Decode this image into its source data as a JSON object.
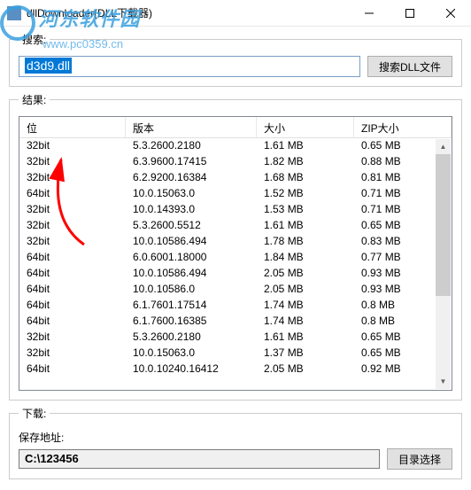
{
  "window": {
    "title": "dllDownloader(DLL下载器)"
  },
  "watermark": {
    "text": "河东软件园",
    "url": "www.pc0359.cn"
  },
  "search": {
    "legend": "搜索:",
    "value": "d3d9.dll",
    "button": "搜索DLL文件"
  },
  "results": {
    "legend": "结果:",
    "headers": {
      "bit": "位",
      "version": "版本",
      "size": "大小",
      "zip": "ZIP大小"
    },
    "rows": [
      {
        "bit": "32bit",
        "version": "5.3.2600.2180",
        "size": "1.61 MB",
        "zip": "0.65 MB"
      },
      {
        "bit": "32bit",
        "version": "6.3.9600.17415",
        "size": "1.82 MB",
        "zip": "0.88 MB"
      },
      {
        "bit": "32bit",
        "version": "6.2.9200.16384",
        "size": "1.68 MB",
        "zip": "0.81 MB"
      },
      {
        "bit": "64bit",
        "version": "10.0.15063.0",
        "size": "1.52 MB",
        "zip": "0.71 MB"
      },
      {
        "bit": "32bit",
        "version": "10.0.14393.0",
        "size": "1.53 MB",
        "zip": "0.71 MB"
      },
      {
        "bit": "32bit",
        "version": "5.3.2600.5512",
        "size": "1.61 MB",
        "zip": "0.65 MB"
      },
      {
        "bit": "32bit",
        "version": "10.0.10586.494",
        "size": "1.78 MB",
        "zip": "0.83 MB"
      },
      {
        "bit": "64bit",
        "version": "6.0.6001.18000",
        "size": "1.84 MB",
        "zip": "0.77 MB"
      },
      {
        "bit": "64bit",
        "version": "10.0.10586.494",
        "size": "2.05 MB",
        "zip": "0.93 MB"
      },
      {
        "bit": "64bit",
        "version": "10.0.10586.0",
        "size": "2.05 MB",
        "zip": "0.93 MB"
      },
      {
        "bit": "64bit",
        "version": "6.1.7601.17514",
        "size": "1.74 MB",
        "zip": "0.8 MB"
      },
      {
        "bit": "64bit",
        "version": "6.1.7600.16385",
        "size": "1.74 MB",
        "zip": "0.8 MB"
      },
      {
        "bit": "32bit",
        "version": "5.3.2600.2180",
        "size": "1.61 MB",
        "zip": "0.65 MB"
      },
      {
        "bit": "32bit",
        "version": "10.0.15063.0",
        "size": "1.37 MB",
        "zip": "0.65 MB"
      },
      {
        "bit": "64bit",
        "version": "10.0.10240.16412",
        "size": "2.05 MB",
        "zip": "0.92 MB"
      }
    ]
  },
  "download": {
    "legend": "下载:",
    "save_label": "保存地址:",
    "path": "C:\\123456",
    "browse": "目录选择"
  }
}
